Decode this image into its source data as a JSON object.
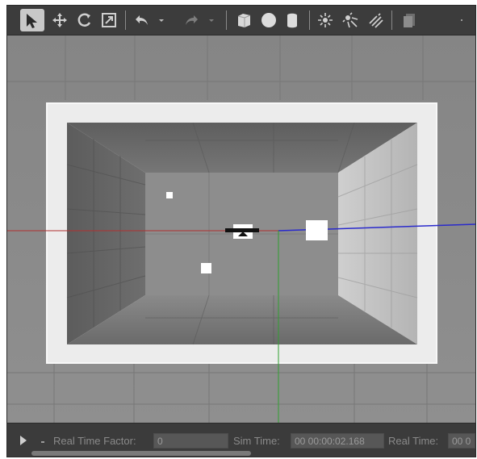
{
  "toolbar": {
    "tools": [
      {
        "name": "select-mode",
        "icon": "arrow-cursor-icon",
        "active": true
      },
      {
        "name": "translate-mode",
        "icon": "move-arrows-icon"
      },
      {
        "name": "rotate-mode",
        "icon": "rotate-icon"
      },
      {
        "name": "scale-mode",
        "icon": "scale-icon"
      },
      {
        "name": "undo",
        "icon": "undo-icon"
      },
      {
        "name": "redo",
        "icon": "redo-icon"
      },
      {
        "name": "box-shape",
        "icon": "box-icon"
      },
      {
        "name": "sphere-shape",
        "icon": "sphere-icon"
      },
      {
        "name": "cylinder-shape",
        "icon": "cylinder-icon"
      },
      {
        "name": "point-light",
        "icon": "point-light-icon"
      },
      {
        "name": "spot-light",
        "icon": "spot-light-icon"
      },
      {
        "name": "directional-light",
        "icon": "directional-light-icon"
      },
      {
        "name": "copy",
        "icon": "copy-icon"
      }
    ]
  },
  "status": {
    "real_time_factor_label": "Real Time Factor:",
    "real_time_factor_value": "0",
    "sim_time_label": "Sim Time:",
    "sim_time_value": "00 00:00:02.168",
    "real_time_label": "Real Time:",
    "real_time_value": "00 0"
  },
  "colors": {
    "toolbar_bg": "#3c3c3c",
    "active_tool_bg": "#c4c4c4",
    "axis_x": "#b03030",
    "axis_y": "#2a2acc",
    "axis_z": "#30a030"
  }
}
